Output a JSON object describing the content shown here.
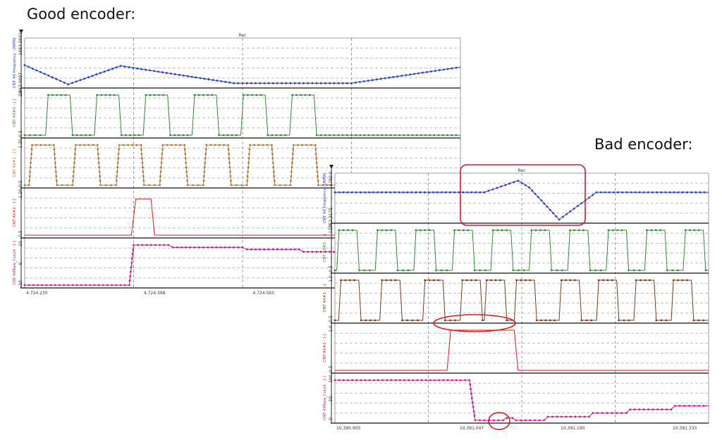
{
  "headings": {
    "good": "Good encoder:",
    "bad": "Bad encoder:"
  },
  "chart_data": [
    {
      "type": "line",
      "name": "good-encoder",
      "title": "Rec",
      "x_ticks": [
        "4.724.230",
        "4.724.398",
        "4.724.565"
      ],
      "x_range": [
        0,
        1
      ],
      "grid": true,
      "panels": [
        {
          "label": "CNT 4X frequency - [RPM]",
          "color": "#1f3bd6",
          "ylim": [
            0,
            1
          ],
          "marker": true,
          "y_ticks": [
            "1664.0001",
            "1663.0007"
          ],
          "points": [
            [
              0,
              0.5
            ],
            [
              0.1,
              0.02
            ],
            [
              0.22,
              0.48
            ],
            [
              0.48,
              0.05
            ],
            [
              0.75,
              0.05
            ],
            [
              1,
              0.45
            ]
          ]
        },
        {
          "label": "CNT 4X#0 - [-]",
          "color": "#2e8b2e",
          "ylim": [
            0,
            1
          ],
          "marker": true,
          "y_ticks": [
            "1.0",
            "0.5"
          ],
          "pulse": {
            "start": 0.048,
            "period": 0.112,
            "width": 0.05,
            "edge": 0.006,
            "count": 6
          }
        },
        {
          "label": "CNT 4X#1 - [-]",
          "color": "#b0763a",
          "ylim": [
            0,
            1
          ],
          "marker": true,
          "y_ticks": [
            "1.20",
            "0.5"
          ],
          "pulse": {
            "start": 0.01,
            "period": 0.1,
            "width": 0.05,
            "edge": 0.007,
            "count": 7
          }
        },
        {
          "label": "CNT 4X#2 - [-]",
          "color": "#e0141e",
          "ylim": [
            0,
            1
          ],
          "marker": false,
          "y_ticks": [
            "1.20",
            "0.5"
          ],
          "points": [
            [
              0,
              0
            ],
            [
              0.245,
              0
            ],
            [
              0.255,
              0.9
            ],
            [
              0.29,
              0.9
            ],
            [
              0.298,
              0
            ],
            [
              1,
              0
            ]
          ]
        },
        {
          "label": "CNT 4XRaw_Count - [-]",
          "color": "#d4148e",
          "ylim": [
            -1,
            1
          ],
          "marker": true,
          "y_ticks": [
            "10",
            "0",
            "-10"
          ],
          "points": [
            [
              0,
              -1
            ],
            [
              0.24,
              -1
            ],
            [
              0.25,
              1
            ],
            [
              0.33,
              1
            ],
            [
              0.34,
              0.88
            ],
            [
              0.5,
              0.88
            ],
            [
              0.51,
              0.78
            ],
            [
              0.63,
              0.78
            ],
            [
              0.64,
              0.66
            ],
            [
              0.78,
              0.66
            ],
            [
              0.79,
              0.54
            ],
            [
              0.92,
              0.54
            ],
            [
              0.93,
              0.43
            ],
            [
              1,
              0.43
            ]
          ]
        }
      ]
    },
    {
      "type": "line",
      "name": "bad-encoder",
      "title": "Rec",
      "x_ticks": [
        "10.390.905",
        "10.391.047",
        "10.391.190",
        "10.391.333"
      ],
      "x_range": [
        0,
        1
      ],
      "grid": true,
      "panels": [
        {
          "label": "CNT 4X frequency - [RPM]",
          "color": "#1f3bd6",
          "ylim": [
            0,
            1
          ],
          "marker": true,
          "y_ticks": [
            "1760.0",
            "1752.3175"
          ],
          "points": [
            [
              0,
              0.7
            ],
            [
              0.4,
              0.7
            ],
            [
              0.49,
              0.99
            ],
            [
              0.52,
              0.82
            ],
            [
              0.6,
              0.02
            ],
            [
              0.7,
              0.7
            ],
            [
              1,
              0.7
            ]
          ]
        },
        {
          "label": "CNT 4X#0 - [-]",
          "color": "#2e8b2e",
          "ylim": [
            0,
            1
          ],
          "marker": true,
          "y_ticks": [
            "1.00",
            "0.5"
          ],
          "pulse": {
            "start": 0.005,
            "period": 0.103,
            "width": 0.048,
            "edge": 0.006,
            "count": 10
          }
        },
        {
          "label": "CNT 4X#1 - [-]",
          "color": "#7a3a12",
          "ylim": [
            0,
            1
          ],
          "marker": true,
          "y_ticks": [
            "1.0",
            "0.5"
          ],
          "pulse_starts": [
            0.01,
            0.12,
            0.235,
            0.335,
            0.4,
            0.48,
            0.6,
            0.7,
            0.8,
            0.9
          ],
          "width": 0.048,
          "edge": 0.006
        },
        {
          "label": "CNT 4X#2 - [-]",
          "color": "#e0141e",
          "ylim": [
            0,
            1
          ],
          "marker": false,
          "y_ticks": [
            "1.0",
            "0.5"
          ],
          "points": [
            [
              0,
              0
            ],
            [
              0.3,
              0
            ],
            [
              0.31,
              1
            ],
            [
              0.48,
              1
            ],
            [
              0.49,
              0
            ],
            [
              1,
              0
            ]
          ]
        },
        {
          "label": "CNT 4XRaw_Count - [-]",
          "color": "#d4148e",
          "ylim": [
            0,
            1
          ],
          "marker": true,
          "y_ticks": [
            "100",
            "50",
            "0"
          ],
          "points": [
            [
              0,
              1
            ],
            [
              0.36,
              1
            ],
            [
              0.375,
              0
            ],
            [
              0.45,
              0
            ],
            [
              0.46,
              0.06
            ],
            [
              0.475,
              0.06
            ],
            [
              0.485,
              0
            ],
            [
              0.56,
              0
            ],
            [
              0.57,
              0.09
            ],
            [
              0.68,
              0.09
            ],
            [
              0.69,
              0.18
            ],
            [
              0.78,
              0.18
            ],
            [
              0.79,
              0.27
            ],
            [
              0.9,
              0.27
            ],
            [
              0.91,
              0.36
            ],
            [
              1,
              0.36
            ]
          ]
        }
      ]
    }
  ],
  "annotations": {
    "color": "#e0141e",
    "bad_encoder": [
      "frequency-glitch-box",
      "flat-pulse-ellipse",
      "count-blip-circle"
    ]
  }
}
